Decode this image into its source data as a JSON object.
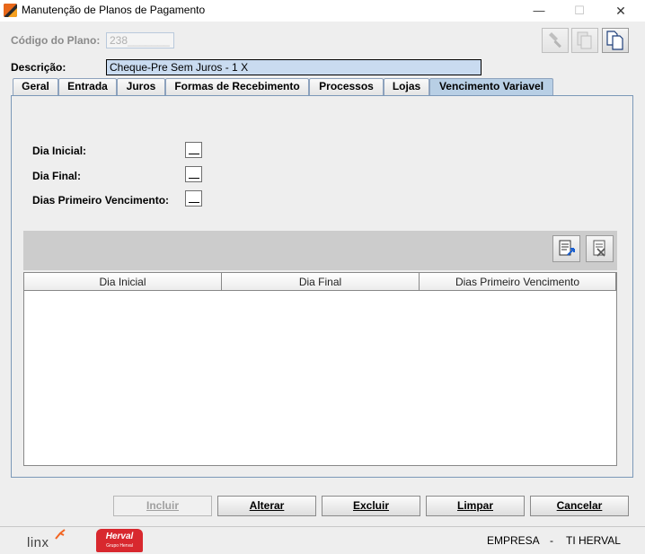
{
  "window": {
    "title": "Manutenção de Planos de Pagamento",
    "minimize_glyph": "—",
    "maximize_glyph": "☐",
    "close_glyph": "✕"
  },
  "header": {
    "codigo_label": "Código do Plano:",
    "codigo_value": "238",
    "descricao_label": "Descrição:",
    "descricao_value": "Cheque-Pre Sem Juros - 1 X"
  },
  "toolbar_icons": [
    "flashlight-icon",
    "copy-pages-icon",
    "new-document-icon"
  ],
  "tabs": [
    {
      "label": "Geral"
    },
    {
      "label": "Entrada"
    },
    {
      "label": "Juros"
    },
    {
      "label": "Formas de Recebimento"
    },
    {
      "label": "Processos"
    },
    {
      "label": "Lojas"
    },
    {
      "label": "Vencimento Variavel",
      "active": true
    }
  ],
  "form": {
    "dia_inicial_label": "Dia Inicial:",
    "dia_final_label": "Dia Final:",
    "dias_primeiro_label": "Dias Primeiro Vencimento:"
  },
  "grid": {
    "columns": [
      "Dia Inicial",
      "Dia Final",
      "Dias Primeiro Vencimento"
    ],
    "rows": []
  },
  "buttons": {
    "incluir": "Incluir",
    "alterar": "Alterar",
    "excluir": "Excluir",
    "limpar": "Limpar",
    "cancelar": "Cancelar"
  },
  "status": {
    "linx_logo": "linx",
    "herval_logo": "Herval",
    "herval_sub": "Grupo Herval",
    "empresa": "EMPRESA",
    "separator": "-",
    "setor": "TI HERVAL"
  },
  "colors": {
    "active_tab": "#b8cfe5",
    "description_field": "#c9dbf0",
    "linx_orange": "#f26522",
    "herval_red": "#d8282e"
  }
}
